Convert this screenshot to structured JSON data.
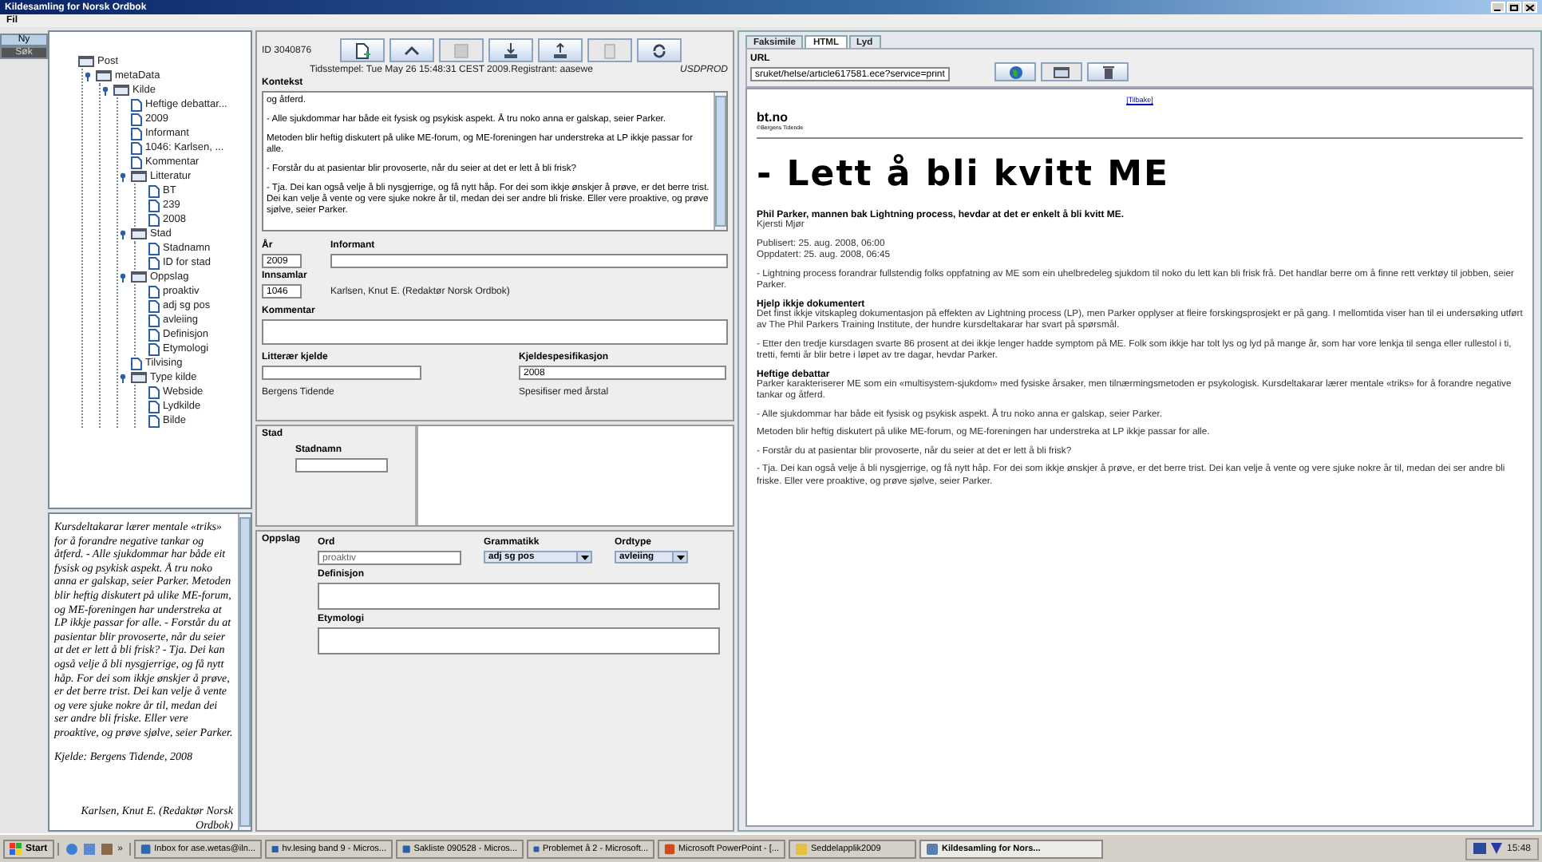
{
  "window": {
    "title": "Kildesamling for Norsk Ordbok"
  },
  "menu": [
    "Fil"
  ],
  "side_tabs": [
    {
      "label": "Ny",
      "selected": true
    },
    {
      "label": "Søk",
      "selected": false
    }
  ],
  "tree": [
    {
      "label": "Post",
      "kind": "folder",
      "expanded": true,
      "children": [
        {
          "label": "metaData",
          "kind": "folder",
          "expanded": true,
          "children": [
            {
              "label": "Kilde",
              "kind": "folder",
              "expanded": true,
              "children": [
                {
                  "label": "Heftige debattar...",
                  "kind": "leaf"
                },
                {
                  "label": "2009",
                  "kind": "leaf"
                },
                {
                  "label": "Informant",
                  "kind": "leaf"
                },
                {
                  "label": "1046: Karlsen, ...",
                  "kind": "leaf"
                },
                {
                  "label": "Kommentar",
                  "kind": "leaf"
                },
                {
                  "label": "Litteratur",
                  "kind": "folder",
                  "expanded": true,
                  "children": [
                    {
                      "label": "BT",
                      "kind": "leaf"
                    },
                    {
                      "label": "239",
                      "kind": "leaf"
                    },
                    {
                      "label": "2008",
                      "kind": "leaf"
                    }
                  ]
                },
                {
                  "label": "Stad",
                  "kind": "folder",
                  "expanded": true,
                  "children": [
                    {
                      "label": "Stadnamn",
                      "kind": "leaf"
                    },
                    {
                      "label": "ID for stad",
                      "kind": "leaf"
                    }
                  ]
                },
                {
                  "label": "Oppslag",
                  "kind": "folder",
                  "expanded": true,
                  "children": [
                    {
                      "label": "proaktiv",
                      "kind": "leaf"
                    },
                    {
                      "label": "adj sg pos",
                      "kind": "leaf"
                    },
                    {
                      "label": "avleiing",
                      "kind": "leaf"
                    },
                    {
                      "label": "Definisjon",
                      "kind": "leaf"
                    },
                    {
                      "label": "Etymologi",
                      "kind": "leaf"
                    }
                  ]
                },
                {
                  "label": "Tilvising",
                  "kind": "leaf"
                },
                {
                  "label": "Type kilde",
                  "kind": "folder",
                  "expanded": true,
                  "children": [
                    {
                      "label": "Webside",
                      "kind": "leaf"
                    },
                    {
                      "label": "Lydkilde",
                      "kind": "leaf"
                    },
                    {
                      "label": "Bilde",
                      "kind": "leaf"
                    }
                  ]
                }
              ]
            }
          ]
        }
      ]
    }
  ],
  "preview": {
    "paragraphs": [
      "Kursdeltakarar lærer mentale «triks» for å forandre negative tankar og åtferd. - Alle sjukdommar har både eit fysisk og psykisk aspekt. Å tru noko anna er galskap, seier Parker. Metoden blir heftig diskutert på ulike ME-forum, og ME-foreningen har understreka at LP ikkje passar for alle. - Forstår du at pasientar blir provoserte, når du seier at det er lett å bli frisk? - Tja. Dei kan også velje å bli nysgjerrige, og få nytt håp. For dei som ikkje ønskjer å prøve, er det berre trist. Dei kan velje å vente og vere sjuke nokre år til, medan dei ser andre bli friske. Eller vere proaktive, og prøve sjølve, seier Parker.",
      "Kjelde: Bergens Tidende, 2008"
    ],
    "signature": "Karlsen, Knut E. (Redaktør Norsk Ordbok)"
  },
  "record": {
    "id": "ID 3040876",
    "toolbar": [
      {
        "kind": "new",
        "disabled": false
      },
      {
        "kind": "up",
        "disabled": false
      },
      {
        "kind": "save",
        "disabled": true
      },
      {
        "kind": "download",
        "disabled": false
      },
      {
        "kind": "upload",
        "disabled": false
      },
      {
        "kind": "clipboard",
        "disabled": true
      },
      {
        "kind": "refresh",
        "disabled": false
      }
    ],
    "timestamp": "Tidsstempel: Tue May 26 15:48:31 CEST 2009.Registrant: aasewe",
    "database": "USDPROD",
    "context": {
      "label": "Kontekst",
      "paragraphs": [
        "og åtferd.",
        "- Alle sjukdommar har både eit fysisk og psykisk aspekt. Å tru noko anna er galskap, seier Parker.",
        "Metoden blir heftig diskutert på ulike ME-forum, og ME-foreningen har understreka at LP ikkje passar for alle.",
        "- Forstår du at pasientar blir provoserte, når du seier at det er lett å bli frisk?",
        "- Tja. Dei kan også velje å bli nysgjerrige, og få nytt håp. For dei som ikkje ønskjer å prøve, er det berre trist. Dei kan velje å vente og vere sjuke nokre år til, medan dei ser andre bli friske. Eller vere proaktive, og prøve sjølve, seier Parker."
      ]
    },
    "year": {
      "label": "År",
      "value": "2009"
    },
    "informant": {
      "label": "Informant"
    },
    "collector": {
      "label": "Innsamlar",
      "value": "1046",
      "name": "Karlsen, Knut E.  (Redaktør Norsk Ordbok)"
    },
    "comment": {
      "label": "Kommentar"
    },
    "literary_source": {
      "label": "Litterær kjelde",
      "note": "Bergens Tidende"
    },
    "source_spec": {
      "label": "Kjeldespesifikasjon",
      "value": "2008",
      "note": "Spesifiser med årstal"
    },
    "place": {
      "title": "Stad",
      "label": "Stadnamn"
    },
    "lookup": {
      "title": "Oppslag",
      "word": {
        "label": "Ord",
        "value": "proaktiv"
      },
      "grammar": {
        "label": "Grammatikk",
        "value": "adj sg pos"
      },
      "word_type": {
        "label": "Ordtype",
        "value": "avleiing"
      },
      "definition": {
        "label": "Definisjon"
      },
      "etymology": {
        "label": "Etymologi"
      }
    }
  },
  "viewer": {
    "tabs": [
      {
        "label": "Faksimile",
        "selected": false
      },
      {
        "label": "HTML",
        "selected": true
      },
      {
        "label": "Lyd",
        "selected": false
      }
    ],
    "url": {
      "label": "URL",
      "value": "sruket/helse/article617581.ece?service=print"
    },
    "buttons": [
      {
        "kind": "globe",
        "disabled": false
      },
      {
        "kind": "folder",
        "disabled": true
      },
      {
        "kind": "trash",
        "disabled": false
      }
    ],
    "page": {
      "back_link": "[Tilbake]",
      "site": "bt.no",
      "site_owner": "©Bergens Tidende",
      "headline": "- Lett å bli kvitt ME",
      "lead": "Phil Parker, mannen bak Lightning process, hevdar at det er enkelt å bli kvitt ME.",
      "author": "Kjersti Mjør",
      "published": "Publisert: 25. aug. 2008, 06:00",
      "updated": "Oppdatert: 25. aug. 2008, 06:45",
      "blocks": [
        {
          "kind": "paragraph",
          "text": "- Lightning process forandrar fullstendig folks oppfatning av ME som ein uhelbredeleg sjukdom til noko du lett kan bli frisk frå. Det handlar berre om å finne rett verktøy til jobben, seier Parker."
        },
        {
          "kind": "section",
          "heading": "Hjelp ikkje dokumentert",
          "text": "Det finst ikkje vitskapleg dokumentasjon på effekten av Lightning process (LP), men Parker opplyser at fleire forskingsprosjekt er på gang. I mellomtida viser han til ei undersøking utført av The Phil Parkers Training Institute, der hundre kursdeltakarar har svart på spørsmål."
        },
        {
          "kind": "paragraph",
          "text": "- Etter den tredje kursdagen svarte 86 prosent at dei ikkje lenger hadde symptom på ME. Folk som ikkje har tolt lys og lyd på mange år, som har vore lenkja til senga eller rullestol i ti, tretti, femti år blir betre i løpet av tre dagar, hevdar Parker."
        },
        {
          "kind": "section",
          "heading": "Heftige debattar",
          "text": "Parker karakteriserer ME som ein «multisystem-sjukdom» med fysiske årsaker, men tilnærmingsmetoden er psykologisk. Kursdeltakarar lærer mentale «triks» for å forandre negative tankar og åtferd."
        },
        {
          "kind": "paragraph",
          "text": "- Alle sjukdommar har både eit fysisk og psykisk aspekt. Å tru noko anna er galskap, seier Parker."
        },
        {
          "kind": "paragraph",
          "text": "Metoden blir heftig diskutert på ulike ME-forum, og ME-foreningen har understreka at LP ikkje passar for alle."
        },
        {
          "kind": "paragraph",
          "text": "- Forstår du at pasientar blir provoserte, når du seier at det er lett å bli frisk?"
        },
        {
          "kind": "paragraph",
          "text": "- Tja. Dei kan også velje å bli nysgjerrige, og få nytt håp. For dei som ikkje ønskjer å prøve, er det berre trist. Dei kan velje å vente og vere sjuke nokre år til, medan dei ser andre bli friske. Eller vere proaktive, og prøve sjølve, seier Parker."
        }
      ]
    }
  },
  "taskbar": {
    "start": "Start",
    "more": "»",
    "tasks": [
      {
        "label": "Inbox for ase.wetas@iln...",
        "kind": "mail",
        "selected": false
      },
      {
        "label": "hv.lesing band 9 - Micros...",
        "kind": "word",
        "selected": false
      },
      {
        "label": "Sakliste 090528 - Micros...",
        "kind": "word",
        "selected": false
      },
      {
        "label": "Problemet å 2 - Microsoft...",
        "kind": "word",
        "selected": false
      },
      {
        "label": "Microsoft PowerPoint - [...",
        "kind": "powerpoint",
        "selected": false
      },
      {
        "label": "Seddelapplik2009",
        "kind": "folder",
        "selected": false
      },
      {
        "label": "Kildesamling for Nors...",
        "kind": "java",
        "selected": true
      }
    ],
    "clock": "15:48"
  }
}
